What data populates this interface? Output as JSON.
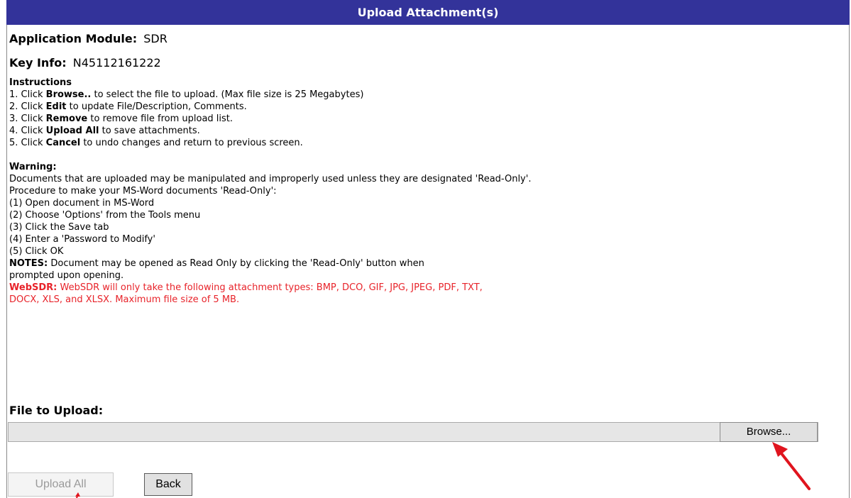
{
  "header": {
    "title": "Upload Attachment(s)"
  },
  "info": {
    "module_label": "Application Module:",
    "module_value": "SDR",
    "key_label": "Key Info:",
    "key_value": "N45112161222"
  },
  "instructions": {
    "title": "Instructions",
    "items": [
      {
        "pre": "1. Click ",
        "bold": "Browse..",
        "post": " to select the file to upload. (Max file size is 25 Megabytes)"
      },
      {
        "pre": "2. Click ",
        "bold": "Edit",
        "post": " to update File/Description, Comments."
      },
      {
        "pre": "3. Click ",
        "bold": "Remove",
        "post": " to remove file from upload list."
      },
      {
        "pre": "4. Click ",
        "bold": "Upload All",
        "post": " to save attachments."
      },
      {
        "pre": "5. Click ",
        "bold": "Cancel",
        "post": " to undo changes and return to previous screen."
      }
    ]
  },
  "warning": {
    "title": "Warning:",
    "lines": [
      "Documents that are uploaded may be manipulated and improperly used unless they are designated 'Read-Only'.",
      "Procedure to make your MS-Word documents 'Read-Only':",
      "(1) Open document in MS-Word",
      "(2) Choose 'Options' from the Tools menu",
      "(3) Click the Save tab",
      "(4) Enter a 'Password to Modify'",
      "(5) Click OK"
    ],
    "notes_label": "NOTES:",
    "notes_text1": " Document may be opened as Read Only by clicking the 'Read-Only' button when",
    "notes_text2": "prompted upon opening.",
    "websdr_label": "WebSDR:",
    "websdr_text1": " WebSDR will only take the following attachment types: BMP, DCO, GIF, JPG, JPEG, PDF, TXT,",
    "websdr_text2": "DOCX, XLS, and XLSX. Maximum file size of 5 MB."
  },
  "upload": {
    "file_label": "File to Upload:",
    "browse_label": "Browse...",
    "upload_all_label": "Upload All",
    "back_label": "Back"
  },
  "colors": {
    "header_bg": "#33339a",
    "warning_red": "#e8232a",
    "annotation_arrow": "#e0141e"
  }
}
